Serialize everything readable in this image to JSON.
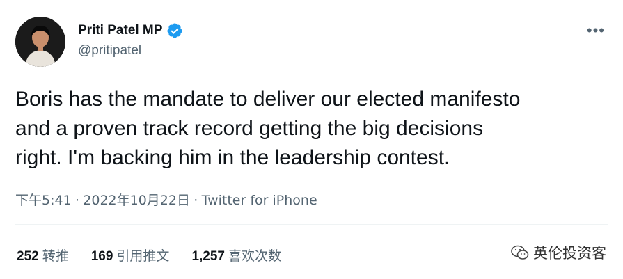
{
  "author": {
    "display_name": "Priti Patel MP",
    "handle": "@pritipatel",
    "verified": true
  },
  "icons": {
    "avatar": "profile-photo",
    "verified": "verified-badge-icon",
    "more": "more-options-icon",
    "watermark": "wechat-icon"
  },
  "tweet": {
    "text": "Boris has the mandate to deliver our elected manifesto\nand a proven track record getting the big decisions\nright.  I'm backing him in the leadership contest.",
    "time": "下午5:41",
    "date": "2022年10月22日",
    "source": "Twitter for iPhone",
    "separator": "·"
  },
  "stats": {
    "retweets_count": "252",
    "retweets_label": "转推",
    "quotes_count": "169",
    "quotes_label": "引用推文",
    "likes_count": "1,257",
    "likes_label": "喜欢次数"
  },
  "watermark": {
    "text": "英伦投资客"
  },
  "colors": {
    "verified_blue": "#1d9bf0",
    "secondary_text": "#536471",
    "primary_text": "#0f1419"
  }
}
